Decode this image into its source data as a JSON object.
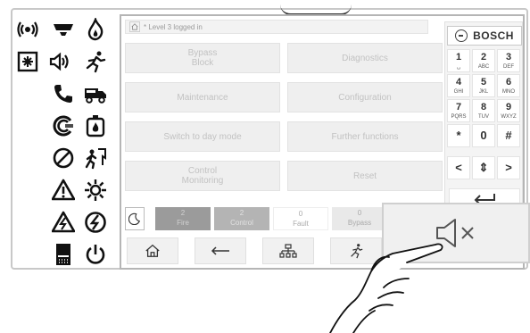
{
  "status_bar": {
    "text": "* Level 3 logged in"
  },
  "menu": {
    "bypass_block": "Bypass\nBlock",
    "diagnostics": "Diagnostics",
    "maintenance": "Maintenance",
    "configuration": "Configuration",
    "switch_day_mode": "Switch to day mode",
    "further_functions": "Further functions",
    "control_monitoring": "Control\nMonitoring",
    "reset": "Reset"
  },
  "keypad": {
    "brand": "BOSCH",
    "keys": [
      {
        "n": "1",
        "l": "␣"
      },
      {
        "n": "2",
        "l": "ABC"
      },
      {
        "n": "3",
        "l": "DEF"
      },
      {
        "n": "4",
        "l": "GHI"
      },
      {
        "n": "5",
        "l": "JKL"
      },
      {
        "n": "6",
        "l": "MNO"
      },
      {
        "n": "7",
        "l": "PQRS"
      },
      {
        "n": "8",
        "l": "TUV"
      },
      {
        "n": "9",
        "l": "WXYZ"
      },
      {
        "n": "*",
        "l": ""
      },
      {
        "n": "0",
        "l": ""
      },
      {
        "n": "#",
        "l": ""
      },
      {
        "n": "<",
        "l": ""
      },
      {
        "n": "⇕",
        "l": ""
      },
      {
        "n": ">",
        "l": ""
      }
    ]
  },
  "counters": {
    "fire": {
      "count": "2",
      "label": "Fire"
    },
    "control": {
      "count": "2",
      "label": "Control"
    },
    "fault": {
      "count": "0",
      "label": "Fault"
    },
    "bypass": {
      "count": "0",
      "label": "Bypass"
    }
  },
  "icons": {
    "leds": [
      "alarm-signal-icon",
      "siren-icon",
      "fire-icon",
      "smoke-detector-icon",
      "loudspeaker-icon",
      "evacuation-icon",
      "phone-icon",
      "fire-truck-icon",
      "extinguishing-icon",
      "sprinkler-icon",
      "disabled-icon",
      "door-release-icon",
      "warning-icon",
      "sun-icon",
      "fault-icon",
      "power-fault-icon",
      "printer-icon",
      "power-icon"
    ],
    "nav": [
      "home-icon",
      "back-arrow-icon",
      "network-icon",
      "evacuation-icon"
    ],
    "silence": "buzzer-mute-icon"
  }
}
